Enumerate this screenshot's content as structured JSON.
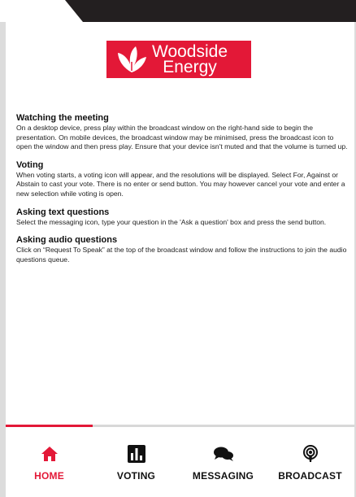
{
  "brand": {
    "line1": "Woodside",
    "line2": "Energy",
    "color": "#e31837"
  },
  "sections": [
    {
      "heading": "Watching the meeting",
      "body": "On a desktop device, press play within the broadcast window on the right-hand side to begin the presentation. On mobile devices, the broadcast window may be minimised, press the broadcast icon to open the window and then press play. Ensure that your device isn't muted and that the volume is turned up."
    },
    {
      "heading": "Voting",
      "body": "When voting starts, a voting icon will appear, and the resolutions will be displayed. Select For, Against or Abstain to cast your vote. There is no enter or send button. You may however cancel your vote and enter a new selection while voting is open."
    },
    {
      "heading": "Asking text questions",
      "body": "Select the messaging icon, type your question in the 'Ask a question' box and press the send button."
    },
    {
      "heading": "Asking audio questions",
      "body": "Click on “Request To Speak” at the top of the broadcast window and follow the instructions to join the audio questions queue."
    }
  ],
  "nav": {
    "active": "home",
    "items": [
      {
        "id": "home",
        "label": "HOME",
        "icon": "home-icon"
      },
      {
        "id": "voting",
        "label": "VOTING",
        "icon": "bar-chart-icon"
      },
      {
        "id": "messaging",
        "label": "MESSAGING",
        "icon": "chat-bubbles-icon"
      },
      {
        "id": "broadcast",
        "label": "BROADCAST",
        "icon": "podcast-icon"
      }
    ]
  }
}
